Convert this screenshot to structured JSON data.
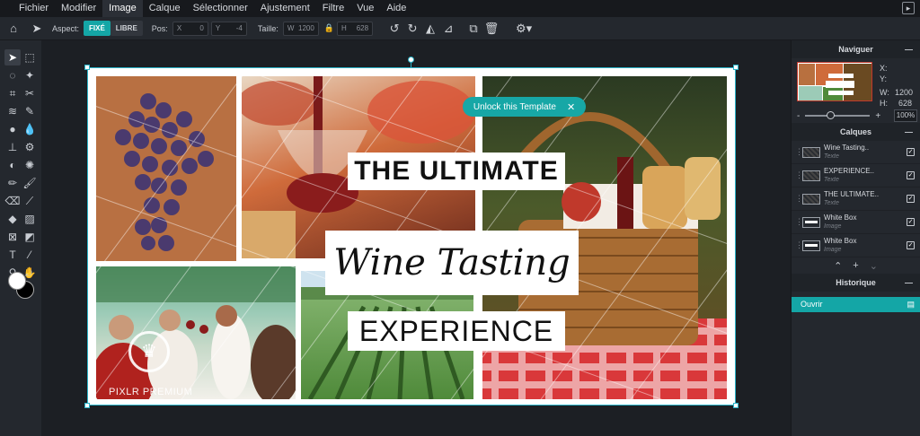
{
  "menu": {
    "items": [
      "Fichier",
      "Modifier",
      "Image",
      "Calque",
      "Sélectionner",
      "Ajustement",
      "Filtre",
      "Vue",
      "Aide"
    ],
    "active": "Image"
  },
  "toolbar": {
    "aspect_label": "Aspect:",
    "fixed_label": "FIXÉ",
    "free_label": "LIBRE",
    "pos_label": "Pos:",
    "x_label": "X",
    "x_value": "0",
    "y_label": "Y",
    "y_value": "-4",
    "size_label": "Taille:",
    "w_label": "W",
    "w_value": "1200",
    "h_label": "H",
    "h_value": "628"
  },
  "canvas": {
    "title_line1": "THE ULTIMATE",
    "title_line2": "Wine Tasting",
    "title_line3": "EXPERIENCE",
    "unlock_label": "Unlock this Template",
    "unlock_close": "✕",
    "premium_text": "PIXLR PREMIUM"
  },
  "navigator": {
    "title": "Naviguer",
    "x_label": "X:",
    "y_label": "Y:",
    "w_label": "W:",
    "w_value": "1200",
    "h_label": "H:",
    "h_value": "628",
    "zoom_minus": "-",
    "zoom_plus": "+",
    "zoom_value": "100%"
  },
  "layers": {
    "title": "Calques",
    "items": [
      {
        "name": "Wine Tasting..",
        "type": "Texte"
      },
      {
        "name": "EXPERIENCE..",
        "type": "Texte"
      },
      {
        "name": "THE ULTIMATE..",
        "type": "Texte"
      },
      {
        "name": "White Box",
        "type": "Image"
      },
      {
        "name": "White Box",
        "type": "Image"
      }
    ]
  },
  "history": {
    "title": "Historique",
    "items": [
      "Ouvrir"
    ]
  },
  "colors": {
    "accent": "#14a6a6",
    "selection": "#2ab3c8",
    "panel": "#24282e",
    "background": "#1c1f24"
  }
}
